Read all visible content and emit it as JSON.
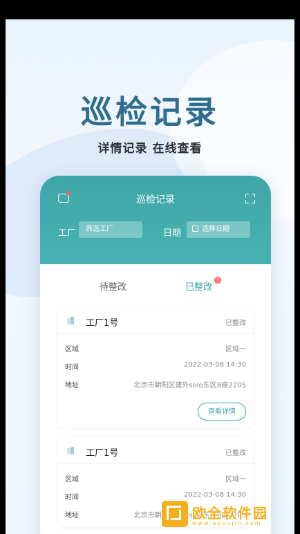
{
  "hero": {
    "title": "巡检记录",
    "subtitle": "详情记录 在线查看"
  },
  "app": {
    "title": "巡检记录",
    "filters": {
      "factory_label": "工厂",
      "factory_placeholder": "筛选工厂",
      "date_label": "日期",
      "date_placeholder": "选择日期"
    },
    "tabs": [
      {
        "label": "待整改",
        "active": false
      },
      {
        "label": "已整改",
        "active": true,
        "badge": "3"
      }
    ],
    "cards": [
      {
        "name": "工厂1号",
        "status": "已整改",
        "rows": [
          {
            "label": "区域",
            "value": "区域一"
          },
          {
            "label": "时间",
            "value": "2022-03-08  14:30"
          },
          {
            "label": "地址",
            "value": "北京市朝阳区建外solo东区B座2205"
          }
        ],
        "detail_label": "查看详情"
      },
      {
        "name": "工厂1号",
        "status": "已整改",
        "rows": [
          {
            "label": "区域",
            "value": "区域一"
          },
          {
            "label": "时间",
            "value": "2022-03-08  14:30"
          },
          {
            "label": "地址",
            "value": "北京市朝阳区建外solo东区B座2205"
          }
        ]
      }
    ]
  },
  "watermark": {
    "name": "欧全软件园",
    "url": "www.apoujin.com"
  },
  "colors": {
    "accent": "#3fa6a8",
    "hero_title": "#2f6d8f",
    "badge": "#ff6b6b",
    "watermark": "#f2b01e"
  }
}
